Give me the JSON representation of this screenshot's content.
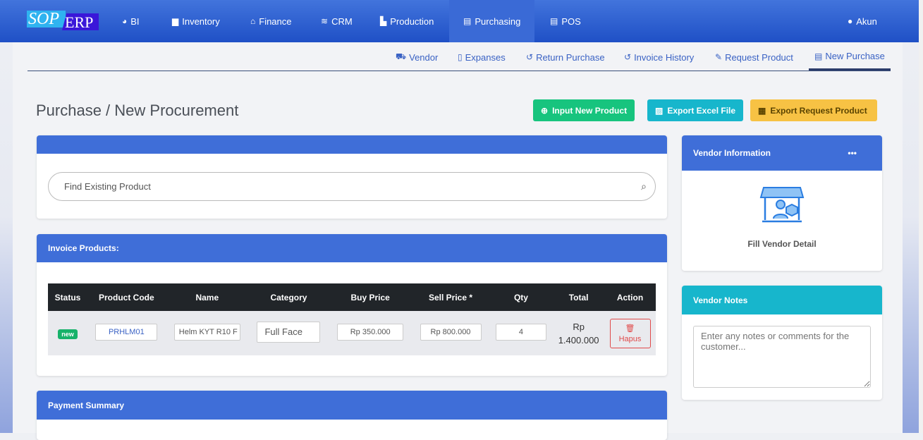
{
  "logo": {
    "part1": "SOP",
    "part2": "ERP"
  },
  "topnav": [
    {
      "label": "BI",
      "icon": "dashboard-icon"
    },
    {
      "label": "Inventory",
      "icon": "box-icon"
    },
    {
      "label": "Finance",
      "icon": "bank-icon"
    },
    {
      "label": "CRM",
      "icon": "layers-icon"
    },
    {
      "label": "Production",
      "icon": "factory-icon"
    },
    {
      "label": "Purchasing",
      "icon": "cart-icon"
    },
    {
      "label": "POS",
      "icon": "store-icon"
    }
  ],
  "account": "Akun",
  "subnav": [
    "Vendor",
    "Expanses",
    "Return Purchase",
    "Invoice History",
    "Request Product",
    "New Purchase"
  ],
  "page_title": "Purchase / New Procurement",
  "buttons": {
    "input_new": "Input New Product",
    "export_excel": "Export Excel File",
    "export_request": "Export Request Product"
  },
  "search": {
    "placeholder": "Find Existing Product"
  },
  "invoice": {
    "title": "Invoice Products:",
    "headers": [
      "Status",
      "Product Code",
      "Name",
      "Category",
      "Buy Price",
      "Sell Price *",
      "Qty",
      "Total",
      "Action"
    ],
    "row": {
      "status": "new",
      "code": "PRHLM01",
      "name": "Helm KYT R10 F",
      "category": "Full Face",
      "buy": "Rp 350.000",
      "sell": "Rp 800.000",
      "qty": "4",
      "total_1": "Rp",
      "total_2": "1.400.000",
      "action": "Hapus"
    }
  },
  "payment": {
    "title": "Payment Summary"
  },
  "vendor": {
    "title": "Vendor Information",
    "more": "•••",
    "fill": "Fill Vendor Detail"
  },
  "notes": {
    "title": "Vendor Notes",
    "placeholder": "Enter any notes or comments for the customer..."
  },
  "colors": {
    "primary": "#3f6ed8",
    "green": "#17c47e",
    "teal": "#17b6cc",
    "yellow": "#f7c244"
  }
}
